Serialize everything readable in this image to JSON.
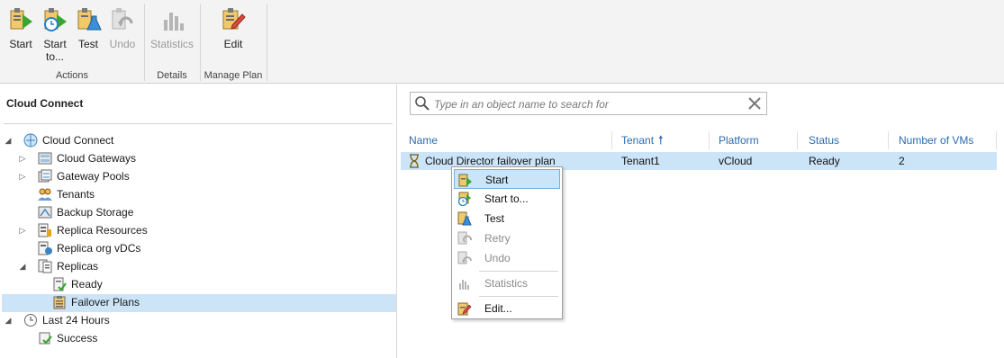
{
  "ribbon": {
    "groups": {
      "actions": "Actions",
      "details": "Details",
      "manage": "Manage Plan"
    },
    "buttons": {
      "start": "Start",
      "start_to_line1": "Start",
      "start_to_line2": "to...",
      "test": "Test",
      "undo": "Undo",
      "statistics": "Statistics",
      "edit": "Edit"
    }
  },
  "left_panel": {
    "title": "Cloud Connect",
    "tree": {
      "cloud_connect": "Cloud Connect",
      "cloud_gateways": "Cloud Gateways",
      "gateway_pools": "Gateway Pools",
      "tenants": "Tenants",
      "backup_storage": "Backup Storage",
      "replica_resources": "Replica Resources",
      "replica_org_vdcs": "Replica org vDCs",
      "replicas": "Replicas",
      "ready": "Ready",
      "failover_plans": "Failover Plans",
      "last_24_hours": "Last 24 Hours",
      "success": "Success"
    }
  },
  "search": {
    "placeholder": "Type in an object name to search for"
  },
  "table": {
    "columns": {
      "name": "Name",
      "tenant": "Tenant",
      "platform": "Platform",
      "status": "Status",
      "vms": "Number of VMs"
    },
    "rows": [
      {
        "name": "Cloud Director failover plan",
        "tenant": "Tenant1",
        "platform": "vCloud",
        "status": "Ready",
        "vms": "2"
      }
    ]
  },
  "context_menu": {
    "start": "Start",
    "start_to": "Start to...",
    "test": "Test",
    "retry": "Retry",
    "undo": "Undo",
    "statistics": "Statistics",
    "edit": "Edit..."
  },
  "colors": {
    "selection": "#cce4f7",
    "header_link": "#2b6cb0",
    "icon_green": "#3aa62f",
    "icon_orange": "#e8a317"
  }
}
